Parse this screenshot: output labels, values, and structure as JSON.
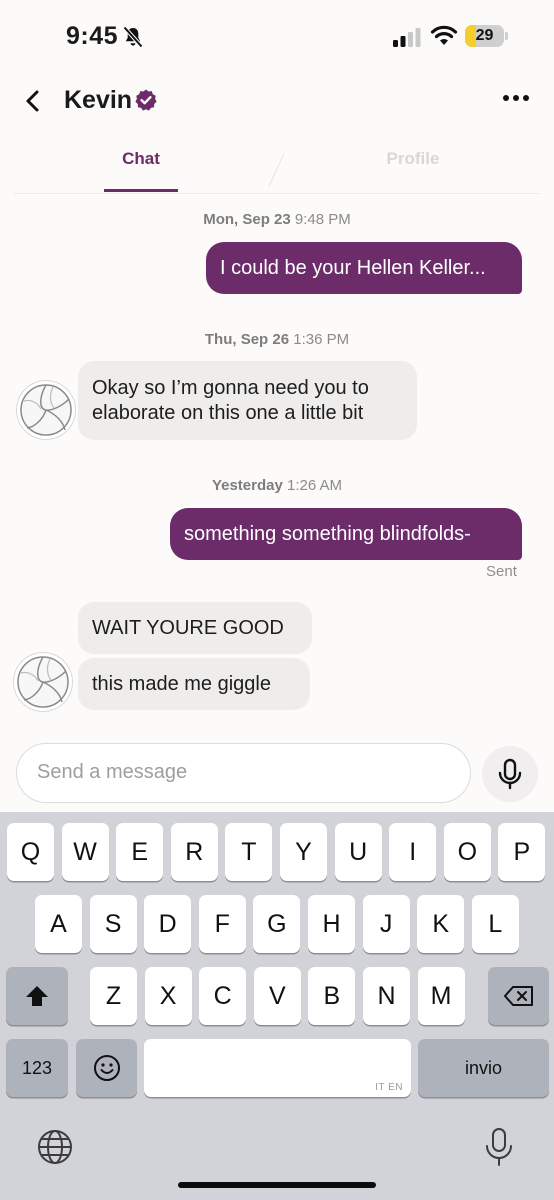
{
  "status_bar": {
    "time": "9:45",
    "battery": "29",
    "battery_level_percent": 29
  },
  "header": {
    "back_icon": "chevron-left-icon",
    "name": "Kevin",
    "verified_icon": "verified-badge-icon",
    "more_icon": "ellipsis-icon"
  },
  "tabs": [
    {
      "label": "Chat",
      "active": true
    },
    {
      "label": "Profile",
      "active": false
    }
  ],
  "conversation": {
    "ts1": {
      "date": "Mon, Sep 23",
      "time": "9:48 PM"
    },
    "msg1": "I could be your Hellen Keller...",
    "ts2": {
      "date": "Thu, Sep 26",
      "time": "1:36 PM"
    },
    "msg2_line1": "Okay so I’m gonna need you to",
    "msg2_line2": "elaborate on this one a little bit",
    "ts3": {
      "date": "Yesterday",
      "time": "1:26 AM"
    },
    "msg3": "something something blindfolds-",
    "msg3_status": "Sent",
    "msg4": "WAIT YOURE GOOD",
    "msg5": "this made me giggle"
  },
  "composer": {
    "placeholder": "Send a message",
    "mic_icon": "microphone-icon"
  },
  "keyboard": {
    "row1": [
      "Q",
      "W",
      "E",
      "R",
      "T",
      "Y",
      "U",
      "I",
      "O",
      "P"
    ],
    "row2": [
      "A",
      "S",
      "D",
      "F",
      "G",
      "H",
      "J",
      "K",
      "L"
    ],
    "row3": [
      "Z",
      "X",
      "C",
      "V",
      "B",
      "N",
      "M"
    ],
    "numbers_key": "123",
    "return_key": "invio",
    "space_lang": "IT EN",
    "icons": [
      "shift-icon",
      "backspace-icon",
      "emoji-icon",
      "globe-icon",
      "dictation-mic-icon"
    ]
  },
  "colors": {
    "accent": "#6b2c69",
    "received_bubble": "#eeedec",
    "keyboard_bg": "#d2d3d8",
    "battery_fill": "#f7cd2e"
  }
}
